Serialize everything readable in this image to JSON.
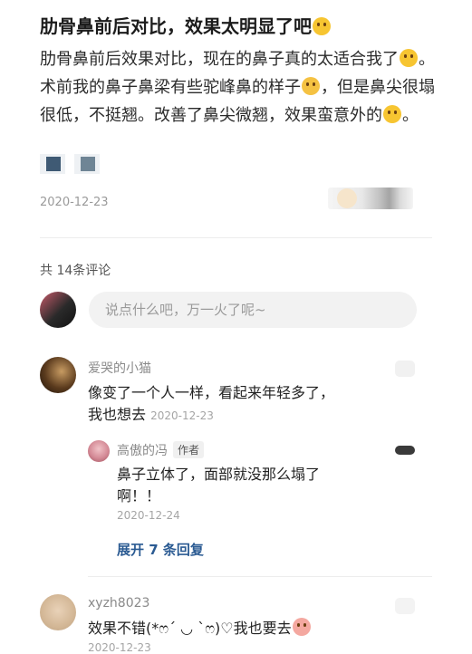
{
  "post": {
    "title": "肋骨鼻前后对比，效果太明显了吧",
    "title_emoji": "face-with-hand-over-mouth-emoji",
    "body_part1": "肋骨鼻前后效果对比，现在的鼻子真的太适合我了",
    "body_part2": "。术前我的鼻子鼻梁有些驼峰鼻的样子",
    "body_part3": "，但是鼻尖很塌很低，不挺翘。改善了鼻尖微翘，效果蛮意外的",
    "body_part4": "。",
    "date": "2020-12-23",
    "thumb_colors": [
      "#3f5a74",
      "#6f8595"
    ]
  },
  "comments_section": {
    "count_label": "共 14条评论",
    "input_placeholder": "说点什么吧，万一火了呢~"
  },
  "comments": [
    {
      "user": "爱哭的小猫",
      "text_line1": "像变了一个人一样，看起来年轻多了，",
      "text_line2": "我也想去",
      "date": "2020-12-23"
    },
    {
      "user": "高傲的冯",
      "author_tag": "作者",
      "text_line1": "鼻子立体了，面部就没那么塌了",
      "text_line2": "啊！！",
      "date": "2020-12-24"
    },
    {
      "user": "xyzh8023",
      "text": "效果不错(*ෆ´ ◡ `ෆ)♡我也要去",
      "date": "2020-12-23"
    }
  ],
  "expand_label": "展开 7 条回复",
  "colors": {
    "link_blue": "#2a5a92",
    "muted": "#9a9a9a"
  }
}
